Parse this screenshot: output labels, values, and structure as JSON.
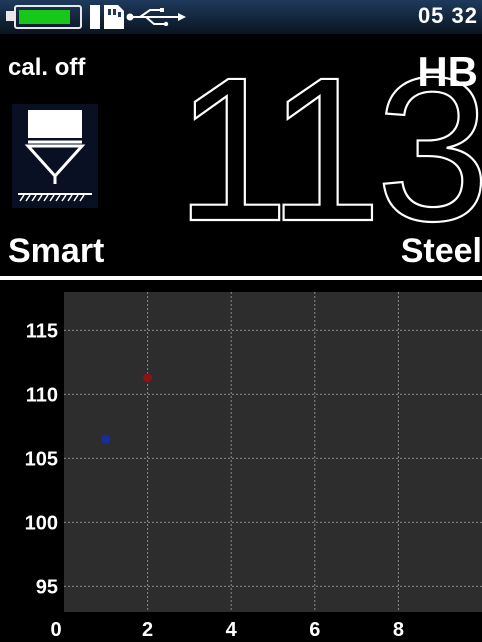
{
  "status": {
    "time": "05 32",
    "battery_level": 0.85,
    "battery_color": "#18c818",
    "icons": [
      "battery-icon",
      "memory-card-icon",
      "usb-icon"
    ]
  },
  "reading": {
    "calibration": "cal. off",
    "scale": "HB",
    "value": "113",
    "mode": "Smart",
    "material": "Steel",
    "indenter_icon": "indenter-icon"
  },
  "chart_data": {
    "type": "scatter",
    "x_ticks": [
      "0",
      "2",
      "4",
      "6",
      "8"
    ],
    "y_ticks": [
      "115",
      "110",
      "105",
      "100",
      "95"
    ],
    "xlim": [
      0,
      10
    ],
    "ylim": [
      93,
      118
    ],
    "grid": true,
    "points": [
      {
        "x": 1,
        "y": 106.5,
        "color": "#1a2aa0"
      },
      {
        "x": 2,
        "y": 111.3,
        "color": "#8a1414"
      }
    ]
  }
}
